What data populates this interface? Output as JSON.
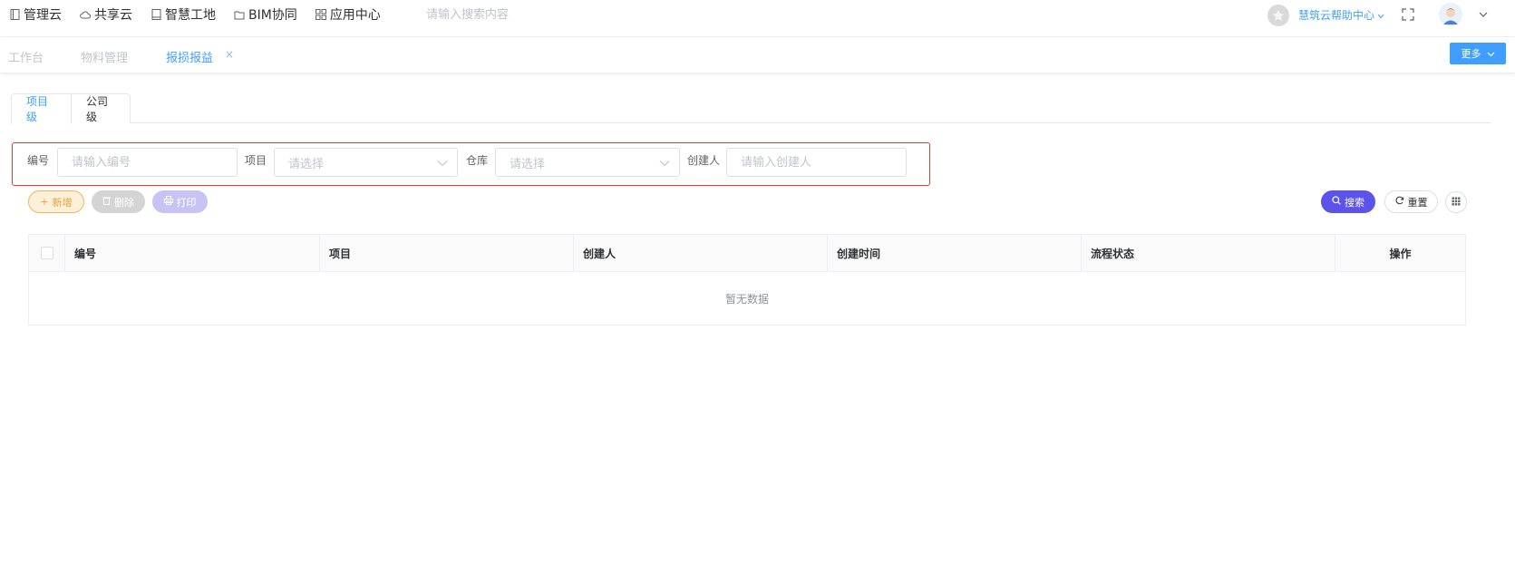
{
  "topnav": {
    "items": [
      {
        "label": "管理云",
        "icon": "book-icon"
      },
      {
        "label": "共享云",
        "icon": "cloud-icon"
      },
      {
        "label": "智慧工地",
        "icon": "book-icon"
      },
      {
        "label": "BIM协同",
        "icon": "folder-icon"
      },
      {
        "label": "应用中心",
        "icon": "grid-icon"
      }
    ],
    "search_placeholder": "请输入搜索内容",
    "help_label": "慧筑云帮助中心"
  },
  "tabs": {
    "items": [
      {
        "label": "工作台",
        "active": false
      },
      {
        "label": "物料管理",
        "active": false
      },
      {
        "label": "报损报益",
        "active": true
      }
    ],
    "close": "×",
    "more_label": "更多"
  },
  "level_tabs": [
    {
      "label": "项目级",
      "active": true
    },
    {
      "label": "公司级",
      "active": false
    }
  ],
  "filters": {
    "code": {
      "label": "编号",
      "placeholder": "请输入编号"
    },
    "project": {
      "label": "项目",
      "placeholder": "请选择"
    },
    "warehouse": {
      "label": "仓库",
      "placeholder": "请选择"
    },
    "creator": {
      "label": "创建人",
      "placeholder": "请输入创建人"
    }
  },
  "actions": {
    "add": "新增",
    "delete": "删除",
    "print": "打印",
    "search": "搜索",
    "reset": "重置"
  },
  "table": {
    "columns": [
      "编号",
      "项目",
      "创建人",
      "创建时间",
      "流程状态",
      "操作"
    ],
    "empty_text": "暂无数据"
  },
  "colors": {
    "primary": "#409eff",
    "search_button": "#5b53ea",
    "highlight_border": "#e53935",
    "add_button": "#e6a23c"
  }
}
